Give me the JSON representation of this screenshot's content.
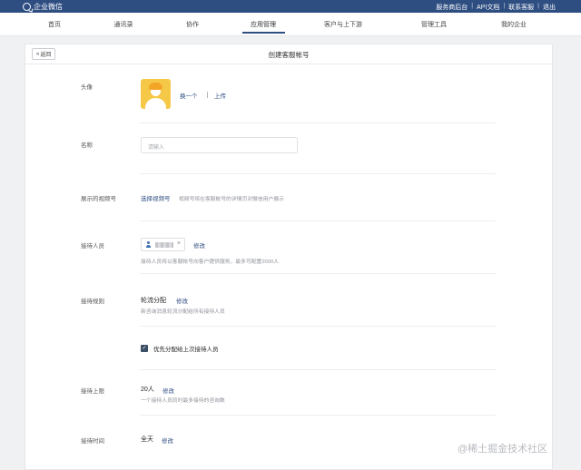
{
  "topbar": {
    "brand": "企业微信",
    "links": [
      "服务商后台",
      "API文档",
      "联系客服",
      "退出"
    ]
  },
  "nav": {
    "items": [
      "首页",
      "通讯录",
      "协作",
      "应用管理",
      "客户与上下游",
      "管理工具",
      "我的企业"
    ],
    "active": "应用管理"
  },
  "page": {
    "back": "返回",
    "title": "创建客服帐号"
  },
  "form": {
    "avatar": {
      "label": "头像",
      "change": "换一个",
      "upload": "上传"
    },
    "name": {
      "label": "名称",
      "placeholder": "请输入"
    },
    "video": {
      "label": "展示的视频号",
      "action": "选择视频号",
      "hint": "视频号将在客服帐号的详情页对微信用户展示"
    },
    "receptionist": {
      "label": "接待人员",
      "edit": "修改",
      "hint": "接待人员将以客服帐号向客户提供服务，最多可配置2000人"
    },
    "rule": {
      "label": "接待规则",
      "value": "轮流分配",
      "edit": "修改",
      "hint": "新咨询消息轮流分配给所有接待人员",
      "priority": "优先分配给上次接待人员"
    },
    "limit": {
      "label": "接待上限",
      "value": "20人",
      "edit": "修改",
      "hint": "一个接待人员同时最多接待的咨询数"
    },
    "time": {
      "label": "接待时间",
      "value": "全天",
      "edit": "修改"
    }
  },
  "watermark": "@稀土掘金技术社区"
}
